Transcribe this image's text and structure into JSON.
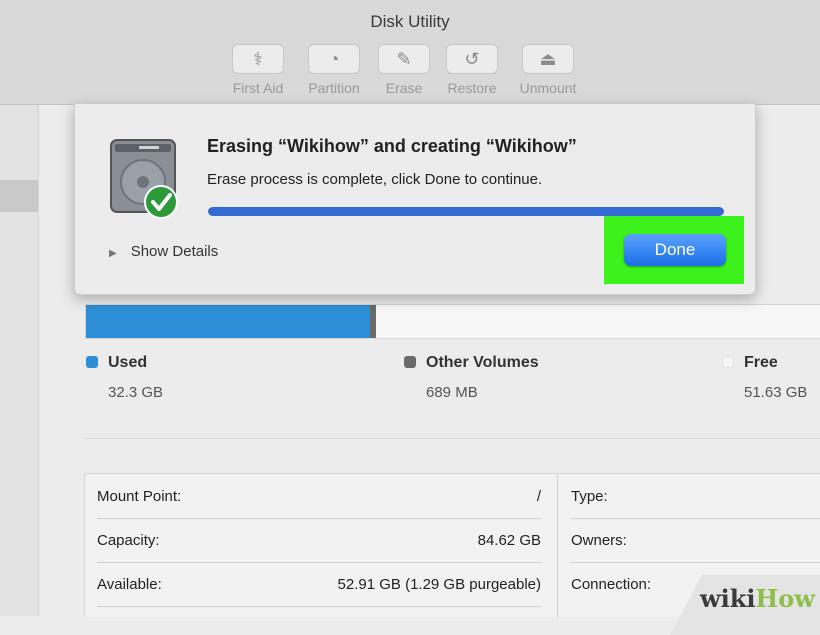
{
  "window": {
    "title": "Disk Utility"
  },
  "toolbar": [
    {
      "label": "First Aid",
      "icon": "stethoscope-icon",
      "glyph": "⚕"
    },
    {
      "label": "Partition",
      "icon": "partition-pie-icon",
      "glyph": "◔"
    },
    {
      "label": "Erase",
      "icon": "erase-drive-icon",
      "glyph": "✎"
    },
    {
      "label": "Restore",
      "icon": "restore-arrow-icon",
      "glyph": "↺"
    },
    {
      "label": "Unmount",
      "icon": "eject-icon",
      "glyph": "⏏"
    }
  ],
  "dialog": {
    "title": "Erasing “Wikihow” and creating “Wikihow”",
    "message": "Erase process is complete, click Done to continue.",
    "progress": 1.0,
    "details_label": "Show Details",
    "done_label": "Done",
    "highlight_color": "#3cf11c"
  },
  "usage": {
    "used_fraction": 0.3865,
    "other_fraction": 0.0083,
    "legend": [
      {
        "name": "Used",
        "value": "32.3 GB",
        "color": "#2f8fd6"
      },
      {
        "name": "Other Volumes",
        "value": "689 MB",
        "color": "#6b6b6b"
      },
      {
        "name": "Free",
        "value": "51.63 GB",
        "color": "#f5f5f5"
      }
    ]
  },
  "info": {
    "left": [
      {
        "key": "Mount Point:",
        "value": "/"
      },
      {
        "key": "Capacity:",
        "value": "84.62 GB"
      },
      {
        "key": "Available:",
        "value": "52.91 GB (1.29 GB purgeable)"
      }
    ],
    "right": [
      {
        "key": "Type:"
      },
      {
        "key": "Owners:"
      },
      {
        "key": "Connection:"
      }
    ]
  },
  "watermark": {
    "part1": "wiki",
    "part2": "How"
  }
}
